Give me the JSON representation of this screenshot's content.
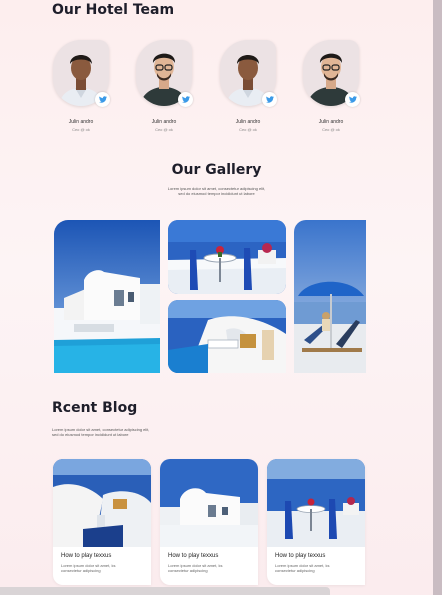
{
  "team": {
    "title": "Our Hotel Team",
    "members": [
      {
        "name": "Julin andro",
        "role": "Ceo @ ok",
        "social": "twitter-icon"
      },
      {
        "name": "Julin andro",
        "role": "Ceo @ ok",
        "social": "twitter-icon"
      },
      {
        "name": "Julin andro",
        "role": "Ceo @ ok",
        "social": "twitter-icon"
      },
      {
        "name": "Julin andro",
        "role": "Ceo @ ok",
        "social": "twitter-icon"
      }
    ]
  },
  "gallery": {
    "title": "Our Gallery",
    "subtitle_line1": "Lorem ipsum dolor sit amet, consectetur adipiscing elit,",
    "subtitle_line2": "sed do eiusmod tempor incididunt ut labore"
  },
  "blog": {
    "title": "Rcent Blog",
    "subtitle_line1": "Lorem ipsum dolor sit amet, consectetur adipiscing elit,",
    "subtitle_line2": "sed do eiusmod tempor incididunt ut labore",
    "posts": [
      {
        "title": "How to play texxus",
        "desc_line1": "Lorem ipsum dolor sit amet, ks",
        "desc_line2": "consectetur adipiscing"
      },
      {
        "title": "How to play texxus",
        "desc_line1": "Lorem ipsum dolor sit amet, ks",
        "desc_line2": "consectetur adipiscing"
      },
      {
        "title": "How to play texxus",
        "desc_line1": "Lorem ipsum dolor sit amet, ks",
        "desc_line2": "consectetur adipiscing"
      }
    ]
  },
  "colors": {
    "accent": "#2b4fa8",
    "twitter": "#3b9ae8",
    "heading": "#1e1e2a"
  }
}
